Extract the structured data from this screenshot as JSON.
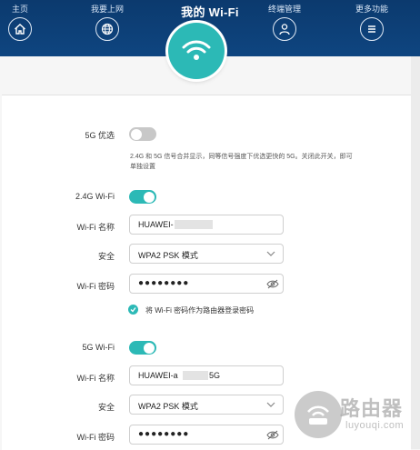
{
  "header": {
    "title": "我的 Wi-Fi",
    "nav": [
      {
        "label": "主页",
        "icon": "home-icon"
      },
      {
        "label": "我要上网",
        "icon": "globe-icon"
      },
      {
        "label": "终端管理",
        "icon": "user-icon"
      },
      {
        "label": "更多功能",
        "icon": "menu-icon"
      }
    ],
    "center_icon": "wifi-icon",
    "accent_color": "#2cb9b6",
    "bar_color": "#0c3a6e"
  },
  "settings": {
    "5g_priority": {
      "label": "5G 优选",
      "enabled": false,
      "hint": "2.4G 和 5G 信号合并显示，同等信号强度下优选更快的 5G。关闭此开关，即可单独设置"
    },
    "wifi_24": {
      "label": "2.4G Wi-Fi",
      "enabled": true,
      "name_label": "Wi-Fi 名称",
      "name_value": "HUAWEI-",
      "security_label": "安全",
      "security_value": "WPA2 PSK 模式",
      "password_label": "Wi-Fi 密码",
      "password_value": "●●●●●●●●",
      "use_as_admin_label": "将 Wi-Fi 密码作为路由器登录密码",
      "use_as_admin_checked": true
    },
    "wifi_5": {
      "label": "5G Wi-Fi",
      "enabled": true,
      "name_label": "Wi-Fi 名称",
      "name_prefix": "HUAWEI-a",
      "name_suffix": "5G",
      "security_label": "安全",
      "security_value": "WPA2 PSK 模式",
      "password_label": "Wi-Fi 密码",
      "password_value": "●●●●●●●●"
    }
  },
  "watermark": {
    "title": "路由器",
    "subtitle": "luyouqi.com"
  }
}
